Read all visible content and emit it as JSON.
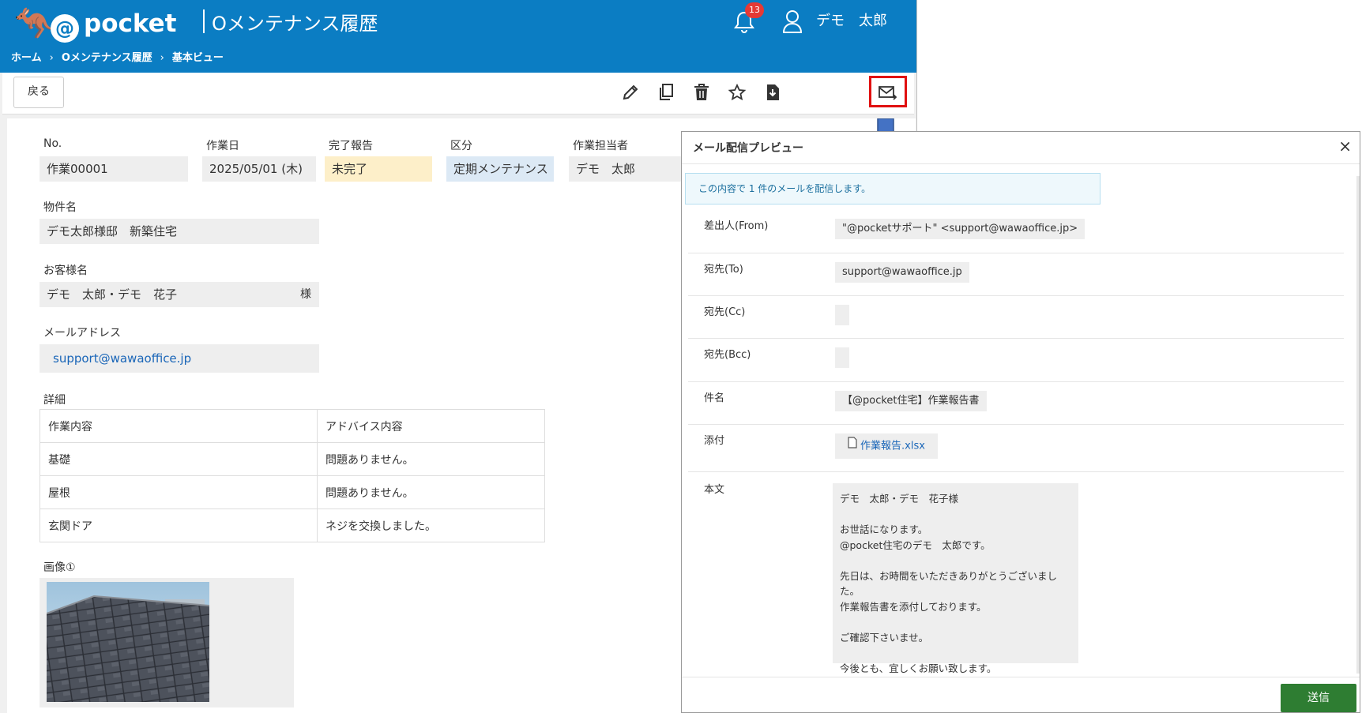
{
  "header": {
    "logo_text": "pocket",
    "title": "Oメンテナンス履歴",
    "notification_count": "13",
    "user_name": "デモ　太郎"
  },
  "breadcrumb": [
    "ホーム",
    "Oメンテナンス履歴",
    "基本ビュー"
  ],
  "toolbar": {
    "back_label": "戻る",
    "icons": [
      "edit-icon",
      "copy-icon",
      "trash-icon",
      "star-icon",
      "download-icon",
      "mail-send-icon"
    ]
  },
  "record": {
    "no_label": "No.",
    "no_value": "作業00001",
    "date_label": "作業日",
    "date_value": "2025/05/01 (木)",
    "report_label": "完了報告",
    "report_value": "未完了",
    "category_label": "区分",
    "category_value": "定期メンテナンス",
    "staff_label": "作業担当者",
    "staff_value": "デモ　太郎",
    "property_label": "物件名",
    "property_value": "デモ太郎様邸　新築住宅",
    "customer_label": "お客様名",
    "customer_value": "デモ　太郎・デモ　花子",
    "customer_suffix": "様",
    "email_label": "メールアドレス",
    "email_value": "support@wawaoffice.jp",
    "detail_label": "詳細",
    "detail_headers": [
      "作業内容",
      "アドバイス内容"
    ],
    "detail_rows": [
      [
        "基礎",
        "問題ありません。"
      ],
      [
        "屋根",
        "問題ありません。"
      ],
      [
        "玄関ドア",
        "ネジを交換しました。"
      ]
    ],
    "image_label": "画像①"
  },
  "modal": {
    "title": "メール配信プレビュー",
    "info": "この内容で 1 件のメールを配信します。",
    "from_label": "差出人(From)",
    "from_value": "\"@pocketサポート\" <support@wawaoffice.jp>",
    "to_label": "宛先(To)",
    "to_value": "support@wawaoffice.jp",
    "cc_label": "宛先(Cc)",
    "bcc_label": "宛先(Bcc)",
    "subject_label": "件名",
    "subject_value": "【@pocket住宅】作業報告書",
    "attach_label": "添付",
    "attach_value": "作業報告.xlsx",
    "body_label": "本文",
    "body_value": "デモ　太郎・デモ　花子様\n\nお世話になります。\n@pocket住宅のデモ　太郎です。\n\n先日は、お時間をいただきありがとうございました。\n作業報告書を添付しております。\n\nご確認下さいませ。\n\n今後とも、宜しくお願い致します。",
    "send_label": "送信"
  },
  "colors": {
    "header_blue": "#0b7dc3",
    "highlight_red": "#e01010",
    "arrow_blue": "#4472c4",
    "send_green": "#2e7d32",
    "badge_red": "#e53935"
  }
}
